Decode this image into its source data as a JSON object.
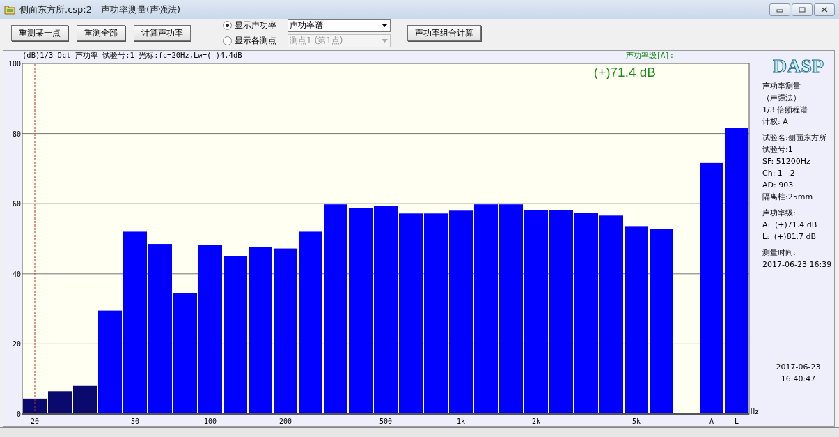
{
  "window": {
    "title": "侧面东方所.csp:2 - 声功率测量(声强法)"
  },
  "toolbar": {
    "buttons": [
      "重测某一点",
      "重测全部",
      "计算声功率"
    ],
    "view_options": [
      {
        "label": "显示声功率",
        "selected": true,
        "dropdown": {
          "value": "声功率谱",
          "disabled": false
        }
      },
      {
        "label": "显示各测点",
        "selected": false,
        "dropdown": {
          "value": "测点1 (第1点)",
          "disabled": true
        }
      }
    ],
    "combine_button": "声功率组合计算"
  },
  "chart": {
    "header": "(dB)1/3 Oct 声功率 试验号:1 光标:fc=20Hz,Lw=(-)4.4dB",
    "level_label": "声功率级[A]:",
    "level_reading": "(+)71.4 dB",
    "chart_data": {
      "type": "bar",
      "xlabel": "Hz",
      "categories": [
        "20",
        null,
        null,
        null,
        "50",
        null,
        null,
        "100",
        null,
        null,
        "200",
        null,
        null,
        null,
        "500",
        null,
        null,
        "1k",
        null,
        null,
        "2k",
        null,
        null,
        null,
        "5k",
        null,
        null,
        "A",
        "L"
      ],
      "series": [
        {
          "color": "#0a0a6e",
          "values": [
            4.4,
            6.5,
            8,
            null,
            null,
            null,
            null,
            null,
            null,
            null,
            null,
            null,
            null,
            null,
            null,
            null,
            null,
            null,
            null,
            null,
            null,
            null,
            null,
            null,
            null,
            null,
            null,
            null,
            null
          ]
        },
        {
          "color": "#0000ff",
          "values": [
            null,
            null,
            null,
            29.5,
            52,
            48.5,
            34.5,
            48.3,
            45,
            47.7,
            47.2,
            52,
            59.8,
            58.8,
            59.3,
            57.2,
            57.2,
            58,
            59.8,
            59.8,
            58.2,
            58.2,
            57.4,
            56.6,
            53.6,
            52.8,
            null,
            71.6,
            81.7
          ]
        }
      ],
      "ylim": [
        0,
        100
      ],
      "yticks": [
        0,
        20,
        40,
        60,
        80,
        100
      ],
      "grid": true,
      "ref_lines": [
        {
          "axis": "x",
          "value": "20",
          "color": "#b03020"
        }
      ]
    }
  },
  "info_panel": {
    "logo": "DASP",
    "groups": [
      [
        "声功率测量",
        "（声强法）",
        "1/3 倍频程谱",
        "计权: A"
      ],
      [
        "试验名:侧面东方所",
        "试验号:1",
        "SF: 51200Hz",
        "Ch: 1 - 2",
        "AD: 903",
        "隔离柱:25mm"
      ],
      [
        "声功率级:",
        "A:  (+)71.4 dB",
        "L:  (+)81.7 dB"
      ],
      [
        "测量时间:",
        "2017-06-23 16:39"
      ]
    ],
    "date": "2017-06-23",
    "time": "16:40:47"
  }
}
